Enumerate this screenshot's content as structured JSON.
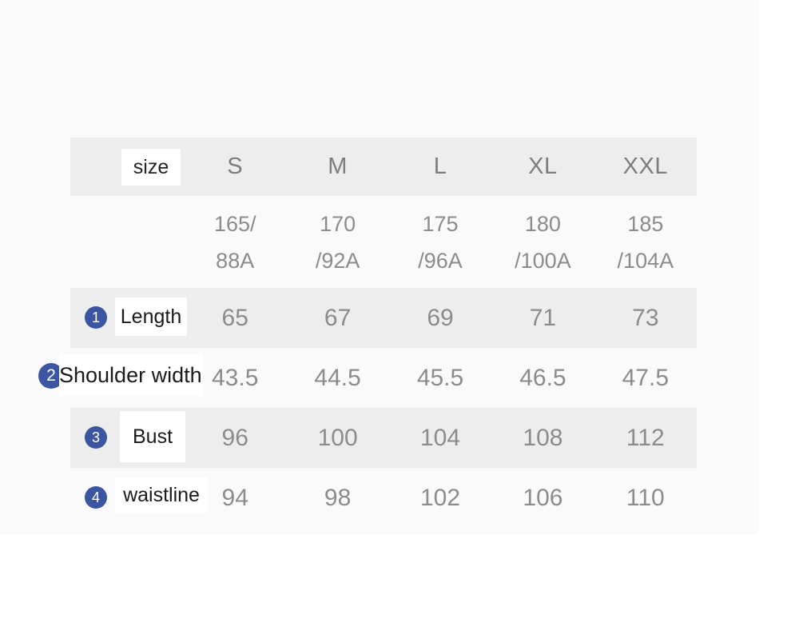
{
  "table": {
    "corner_label": "size",
    "size_columns": [
      "S",
      "M",
      "L",
      "XL",
      "XXL"
    ],
    "spec_rows": [
      {
        "line1": "165/",
        "line2": "88A"
      },
      {
        "line1": "170",
        "line2": "/92A"
      },
      {
        "line1": "175",
        "line2": "/96A"
      },
      {
        "line1": "180",
        "line2": "/100A"
      },
      {
        "line1": "185",
        "line2": "/104A"
      }
    ],
    "measurement_rows": [
      {
        "number": "1",
        "label": "Length",
        "values": [
          "65",
          "67",
          "69",
          "71",
          "73"
        ]
      },
      {
        "number": "2",
        "label": "Shoulder width",
        "values": [
          "43.5",
          "44.5",
          "45.5",
          "46.5",
          "47.5"
        ]
      },
      {
        "number": "3",
        "label": "Bust",
        "values": [
          "96",
          "100",
          "104",
          "108",
          "112"
        ]
      },
      {
        "number": "4",
        "label": "waistline",
        "values": [
          "94",
          "98",
          "102",
          "106",
          "110"
        ]
      }
    ]
  },
  "colors": {
    "bullet_blue": "#3b55a0",
    "row_shade": "#ededed",
    "row_light": "#fafafa",
    "value_text": "#8c8c8c",
    "label_text": "#1a1a1a"
  }
}
